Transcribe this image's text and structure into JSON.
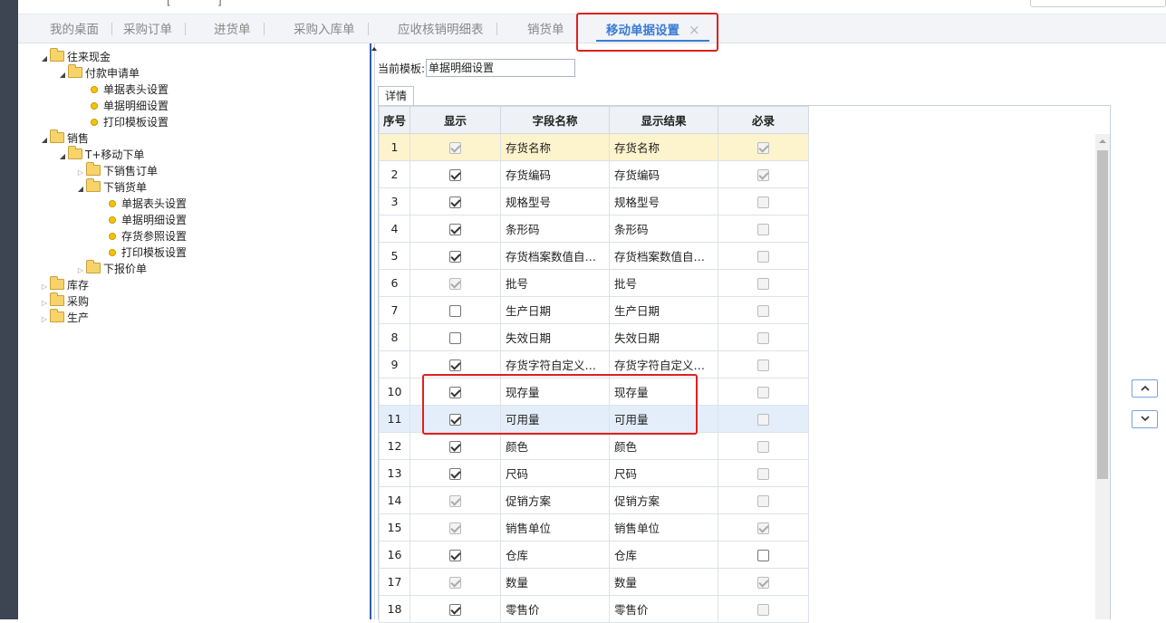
{
  "top_strip": {
    "fragments": [
      "[",
      "]"
    ],
    "search_placeholder": ""
  },
  "tabs": [
    {
      "label": "我的桌面"
    },
    {
      "label": "采购订单"
    },
    {
      "label": "进货单"
    },
    {
      "label": "采购入库单"
    },
    {
      "label": "应收核销明细表"
    },
    {
      "label": "销货单"
    },
    {
      "label": "移动单据设置",
      "active": true,
      "close": "×"
    }
  ],
  "tree": {
    "n1": "往来现金",
    "n2": "付款申请单",
    "n3": "单据表头设置",
    "n4": "单据明细设置",
    "n5": "打印模板设置",
    "n6": "销售",
    "n7": "T+移动下单",
    "n8": "下销售订单",
    "n9": "下销货单",
    "n10": "单据表头设置",
    "n11": "单据明细设置",
    "n12": "存货参照设置",
    "n13": "打印模板设置",
    "n14": "下报价单",
    "n15": "库存",
    "n16": "采购",
    "n17": "生产"
  },
  "template": {
    "label": "当前模板:",
    "value": "单据明细设置"
  },
  "detail_tab": "详情",
  "grid": {
    "headers": {
      "seq": "序号",
      "show": "显示",
      "field": "字段名称",
      "result": "显示结果",
      "required": "必录"
    },
    "rows": [
      {
        "seq": "1",
        "show": true,
        "show_disabled": true,
        "field": "存货名称",
        "result": "存货名称",
        "required": true,
        "required_disabled": true
      },
      {
        "seq": "2",
        "show": true,
        "show_disabled": false,
        "field": "存货编码",
        "result": "存货编码",
        "required": true,
        "required_disabled": true
      },
      {
        "seq": "3",
        "show": true,
        "show_disabled": false,
        "field": "规格型号",
        "result": "规格型号",
        "required": false,
        "required_disabled": true
      },
      {
        "seq": "4",
        "show": true,
        "show_disabled": false,
        "field": "条形码",
        "result": "条形码",
        "required": false,
        "required_disabled": true
      },
      {
        "seq": "5",
        "show": true,
        "show_disabled": false,
        "field": "存货档案数值自…",
        "result": "存货档案数值自…",
        "required": false,
        "required_disabled": true
      },
      {
        "seq": "6",
        "show": true,
        "show_disabled": true,
        "field": "批号",
        "result": "批号",
        "required": false,
        "required_disabled": true
      },
      {
        "seq": "7",
        "show": false,
        "show_disabled": false,
        "field": "生产日期",
        "result": "生产日期",
        "required": false,
        "required_disabled": true
      },
      {
        "seq": "8",
        "show": false,
        "show_disabled": false,
        "field": "失效日期",
        "result": "失效日期",
        "required": false,
        "required_disabled": true
      },
      {
        "seq": "9",
        "show": true,
        "show_disabled": false,
        "field": "存货字符自定义…",
        "result": "存货字符自定义…",
        "required": false,
        "required_disabled": true
      },
      {
        "seq": "10",
        "show": true,
        "show_disabled": false,
        "field": "现存量",
        "result": "现存量",
        "required": false,
        "required_disabled": true
      },
      {
        "seq": "11",
        "show": true,
        "show_disabled": false,
        "field": "可用量",
        "result": "可用量",
        "required": false,
        "required_disabled": true
      },
      {
        "seq": "12",
        "show": true,
        "show_disabled": false,
        "field": "颜色",
        "result": "颜色",
        "required": false,
        "required_disabled": true
      },
      {
        "seq": "13",
        "show": true,
        "show_disabled": false,
        "field": "尺码",
        "result": "尺码",
        "required": false,
        "required_disabled": true
      },
      {
        "seq": "14",
        "show": true,
        "show_disabled": true,
        "field": "促销方案",
        "result": "促销方案",
        "required": false,
        "required_disabled": true
      },
      {
        "seq": "15",
        "show": true,
        "show_disabled": true,
        "field": "销售单位",
        "result": "销售单位",
        "required": true,
        "required_disabled": true
      },
      {
        "seq": "16",
        "show": true,
        "show_disabled": false,
        "field": "仓库",
        "result": "仓库",
        "required": false,
        "required_disabled": false
      },
      {
        "seq": "17",
        "show": true,
        "show_disabled": true,
        "field": "数量",
        "result": "数量",
        "required": true,
        "required_disabled": true
      },
      {
        "seq": "18",
        "show": true,
        "show_disabled": false,
        "field": "零售价",
        "result": "零售价",
        "required": false,
        "required_disabled": true
      }
    ]
  },
  "colors": {
    "accent": "#3a7bd5",
    "highlight_box": "#e02020",
    "selected_row": "#fdf3cc",
    "hover_row": "#e3eefa"
  }
}
